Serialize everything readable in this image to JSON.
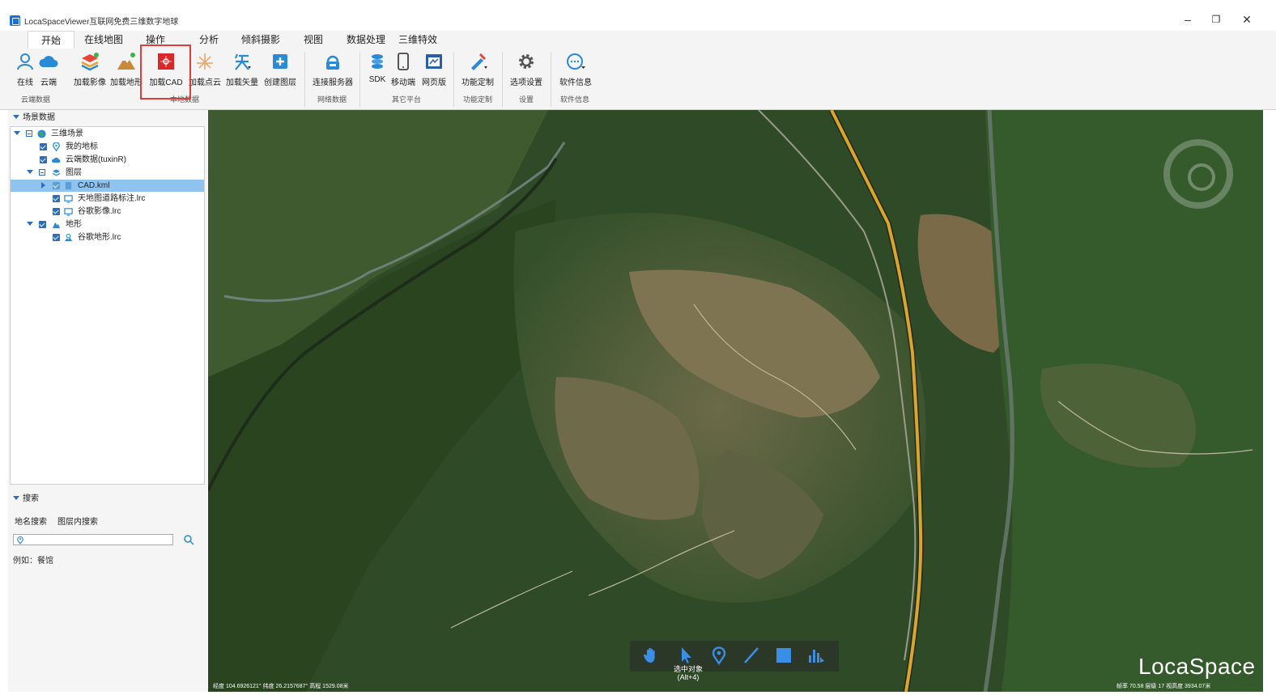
{
  "window": {
    "title": "LocaSpaceViewer互联网免费三维数字地球",
    "minimize_icon": "minimize-icon",
    "restore_icon": "restore-icon",
    "close_icon": "close-icon"
  },
  "menu": {
    "tabs": [
      "开始",
      "在线地图",
      "操作",
      "分析",
      "倾斜摄影",
      "视图",
      "数据处理",
      "三维特效"
    ],
    "active": "开始"
  },
  "ribbon": {
    "buttons": [
      {
        "label": "在线",
        "icon": "user-icon"
      },
      {
        "label": "云端",
        "icon": "cloud-icon"
      },
      {
        "label": "加载影像",
        "icon": "layers-icon"
      },
      {
        "label": "加载地形",
        "icon": "terrain-icon"
      },
      {
        "label": "加载CAD",
        "icon": "cad-icon"
      },
      {
        "label": "加载点云",
        "icon": "point-cloud-icon"
      },
      {
        "label": "加载矢量",
        "icon": "vector-icon"
      },
      {
        "label": "创建图层",
        "icon": "add-layer-icon"
      },
      {
        "label": "连接服务器",
        "icon": "server-icon"
      },
      {
        "label": "SDK",
        "icon": "sdk-icon"
      },
      {
        "label": "移动端",
        "icon": "mobile-icon"
      },
      {
        "label": "网页版",
        "icon": "web-icon"
      },
      {
        "label": "功能定制",
        "icon": "customize-icon"
      },
      {
        "label": "选项设置",
        "icon": "gear-icon"
      },
      {
        "label": "软件信息",
        "icon": "info-icon"
      }
    ],
    "groups": [
      "云端数据",
      "本地数据",
      "网络数据",
      "其它平台",
      "功能定制",
      "设置",
      "软件信息"
    ]
  },
  "scene_panel": {
    "header": "场景数据",
    "tree": [
      {
        "label": "三维场景",
        "icon": "globe-icon"
      },
      {
        "label": "我的地标",
        "icon": "pin-icon"
      },
      {
        "label": "云端数据(tuxinR)",
        "icon": "cloud-icon"
      },
      {
        "label": "图层",
        "icon": "layers-icon"
      },
      {
        "label": "CAD.kml",
        "icon": "file-icon"
      },
      {
        "label": "天地图道路标注.lrc",
        "icon": "monitor-icon"
      },
      {
        "label": "谷歌影像.lrc",
        "icon": "monitor-icon"
      },
      {
        "label": "地形",
        "icon": "terrain-icon"
      },
      {
        "label": "谷歌地形.lrc",
        "icon": "terrain-layer-icon"
      }
    ]
  },
  "search_panel": {
    "header": "搜索",
    "tabs": [
      "地名搜索",
      "图层内搜索"
    ],
    "value": "",
    "hint": "例如：餐馆"
  },
  "map": {
    "select_tip_line1": "选中对象",
    "select_tip_line2": "(Alt+4)",
    "brand": "LocaSpace",
    "status_left": "经度 104.6926121°  纬度 26.2157687°  高程 1529.08米",
    "status_right": "帧率 70.58  层级 17  视高度 3934.07米",
    "tools": [
      "hand-icon",
      "pointer-icon",
      "placemark-icon",
      "line-icon",
      "polygon-icon",
      "measure-icon"
    ],
    "colors": {
      "road": "#d9a52c",
      "vegetation": "#3b5a2a",
      "terrace": "#8a7a55"
    }
  },
  "colors": {
    "accent": "#2a6ebd",
    "highlight": "#e23b3b",
    "selection": "#8fc4f0"
  }
}
